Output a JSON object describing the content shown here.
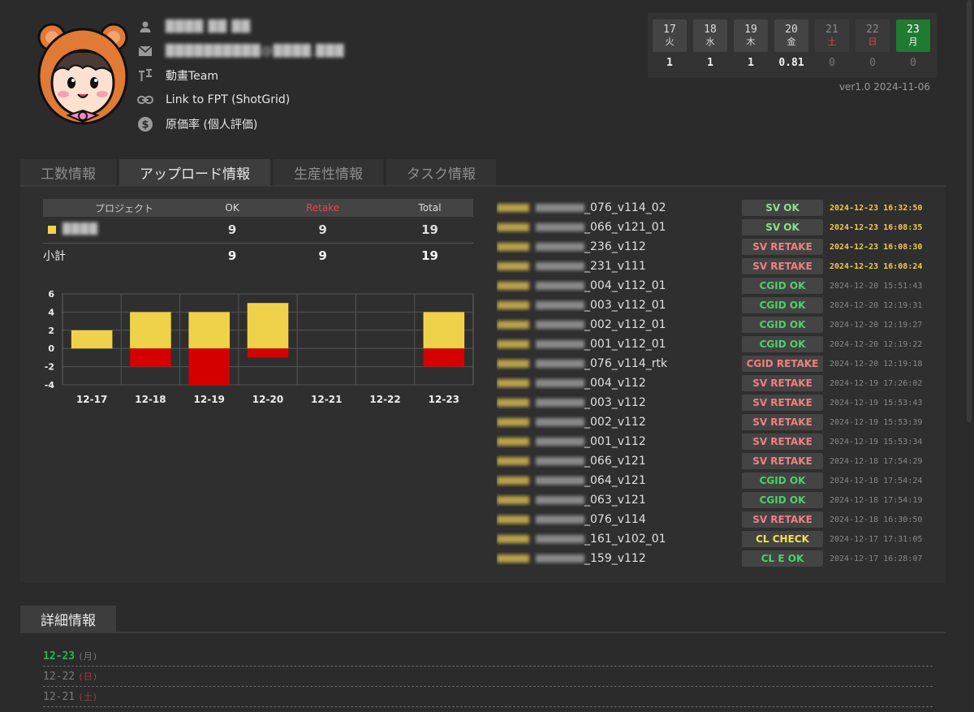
{
  "profile": {
    "name": "████ ██ ██",
    "email": "██████████@████.███",
    "team": "動畫Team",
    "link": "Link to FPT (ShotGrid)",
    "cost": "原価率 (個人評価)"
  },
  "week": [
    {
      "d": "17",
      "w": "火",
      "val": "1",
      "state": "normal"
    },
    {
      "d": "18",
      "w": "水",
      "val": "1",
      "state": "normal"
    },
    {
      "d": "19",
      "w": "木",
      "val": "1",
      "state": "normal"
    },
    {
      "d": "20",
      "w": "金",
      "val": "0.81",
      "state": "normal"
    },
    {
      "d": "21",
      "w": "土",
      "val": "0",
      "state": "sat"
    },
    {
      "d": "22",
      "w": "日",
      "val": "0",
      "state": "sun"
    },
    {
      "d": "23",
      "w": "月",
      "val": "0",
      "state": "today"
    }
  ],
  "version": "ver1.0  2024-11-06",
  "tabs": [
    "工数情報",
    "アップロード情報",
    "生産性情報",
    "タスク情報"
  ],
  "summary": {
    "headers": {
      "project": "プロジェクト",
      "ok": "OK",
      "retake": "Retake",
      "total": "Total"
    },
    "row": {
      "name": "████",
      "ok": "9",
      "retake": "9",
      "total": "19"
    },
    "subtotal": {
      "label": "小計",
      "ok": "9",
      "retake": "9",
      "total": "19"
    }
  },
  "chart_data": {
    "type": "bar",
    "categories": [
      "12-17",
      "12-18",
      "12-19",
      "12-20",
      "12-21",
      "12-22",
      "12-23"
    ],
    "series": [
      {
        "values": [
          2,
          4,
          4,
          5,
          0,
          0,
          4
        ],
        "color": "#f0d24a"
      },
      {
        "values": [
          0,
          -2,
          -4,
          -1,
          0,
          0,
          -2
        ],
        "color": "#d40000"
      }
    ],
    "ylim": [
      -4,
      6
    ],
    "yticks": [
      6,
      4,
      2,
      0,
      -2,
      -4
    ],
    "grid": true
  },
  "uploads": [
    {
      "suffix": "_076_v114_02",
      "status": "SV OK",
      "kind": "ok",
      "date": "2024-12-23 16:32:50",
      "today": true
    },
    {
      "suffix": "_066_v121_01",
      "status": "SV OK",
      "kind": "ok",
      "date": "2024-12-23 16:08:35",
      "today": true
    },
    {
      "suffix": "_236_v112",
      "status": "SV RETAKE",
      "kind": "rt",
      "date": "2024-12-23 16:08:30",
      "today": true
    },
    {
      "suffix": "_231_v111",
      "status": "SV RETAKE",
      "kind": "rt",
      "date": "2024-12-23 16:08:24",
      "today": true
    },
    {
      "suffix": "_004_v112_01",
      "status": "CGID OK",
      "kind": "cgok",
      "date": "2024-12-20 15:51:43",
      "today": false
    },
    {
      "suffix": "_003_v112_01",
      "status": "CGID OK",
      "kind": "cgok",
      "date": "2024-12-20 12:19:31",
      "today": false
    },
    {
      "suffix": "_002_v112_01",
      "status": "CGID OK",
      "kind": "cgok",
      "date": "2024-12-20 12:19:27",
      "today": false
    },
    {
      "suffix": "_001_v112_01",
      "status": "CGID OK",
      "kind": "cgok",
      "date": "2024-12-20 12:19:22",
      "today": false
    },
    {
      "suffix": "_076_v114_rtk",
      "status": "CGID RETAKE",
      "kind": "rt",
      "date": "2024-12-20 12:19:18",
      "today": false
    },
    {
      "suffix": "_004_v112",
      "status": "SV RETAKE",
      "kind": "rt",
      "date": "2024-12-19 17:26:02",
      "today": false
    },
    {
      "suffix": "_003_v112",
      "status": "SV RETAKE",
      "kind": "rt",
      "date": "2024-12-19 15:53:43",
      "today": false
    },
    {
      "suffix": "_002_v112",
      "status": "SV RETAKE",
      "kind": "rt",
      "date": "2024-12-19 15:53:39",
      "today": false
    },
    {
      "suffix": "_001_v112",
      "status": "SV RETAKE",
      "kind": "rt",
      "date": "2024-12-19 15:53:34",
      "today": false
    },
    {
      "suffix": "_066_v121",
      "status": "SV RETAKE",
      "kind": "rt",
      "date": "2024-12-18 17:54:29",
      "today": false
    },
    {
      "suffix": "_064_v121",
      "status": "CGID OK",
      "kind": "cgok",
      "date": "2024-12-18 17:54:24",
      "today": false
    },
    {
      "suffix": "_063_v121",
      "status": "CGID OK",
      "kind": "cgok",
      "date": "2024-12-18 17:54:19",
      "today": false
    },
    {
      "suffix": "_076_v114",
      "status": "SV RETAKE",
      "kind": "rt",
      "date": "2024-12-18 16:30:50",
      "today": false
    },
    {
      "suffix": "_161_v102_01",
      "status": "CL CHECK",
      "kind": "chk",
      "date": "2024-12-17 17:31:05",
      "today": false
    },
    {
      "suffix": "_159_v112",
      "status": "CL E OK",
      "kind": "cgok",
      "date": "2024-12-17 16:28:07",
      "today": false
    }
  ],
  "details": {
    "title": "詳細情報",
    "days": [
      {
        "date": "12-23",
        "wd": "(月)",
        "state": "today"
      },
      {
        "date": "12-22",
        "wd": "(日)",
        "state": "wkend"
      },
      {
        "date": "12-21",
        "wd": "(土)",
        "state": "wkend"
      }
    ]
  }
}
